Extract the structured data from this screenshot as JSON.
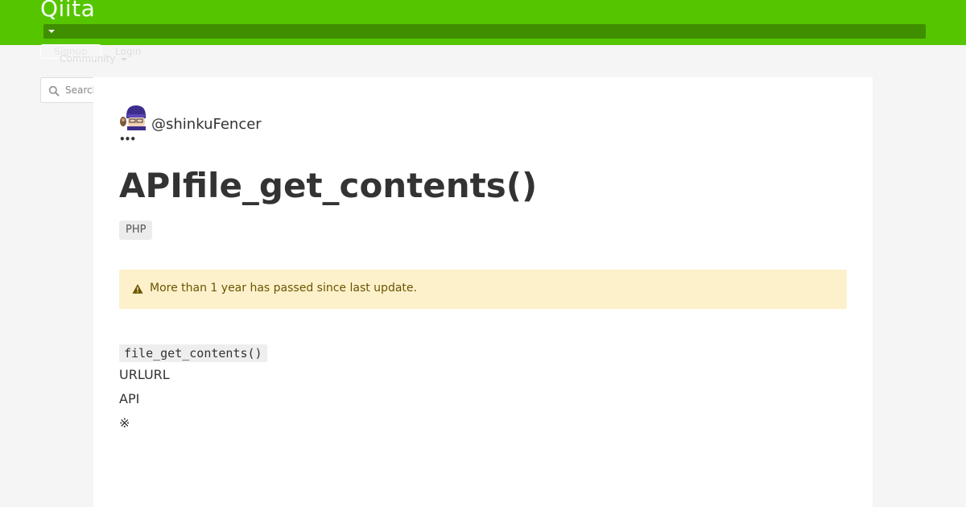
{
  "header": {
    "logo": "Qiita",
    "signup_label": "Signup",
    "login_label": "Login",
    "community_label": "Community"
  },
  "search": {
    "placeholder": "Search"
  },
  "article": {
    "author": "@shinkuFencer",
    "more_label": "•••",
    "title": "APIfile_get_contents()",
    "tags": [
      "PHP"
    ],
    "alert": "More than 1 year has passed since last update.",
    "body": {
      "code": "file_get_contents()",
      "paragraphs": [
        "URLURL",
        "API",
        "※"
      ]
    }
  },
  "colors": {
    "brand": "#55c500",
    "brand_dark": "#3f8f00",
    "alert_bg": "#fdf1cc",
    "alert_text": "#6b5400"
  }
}
